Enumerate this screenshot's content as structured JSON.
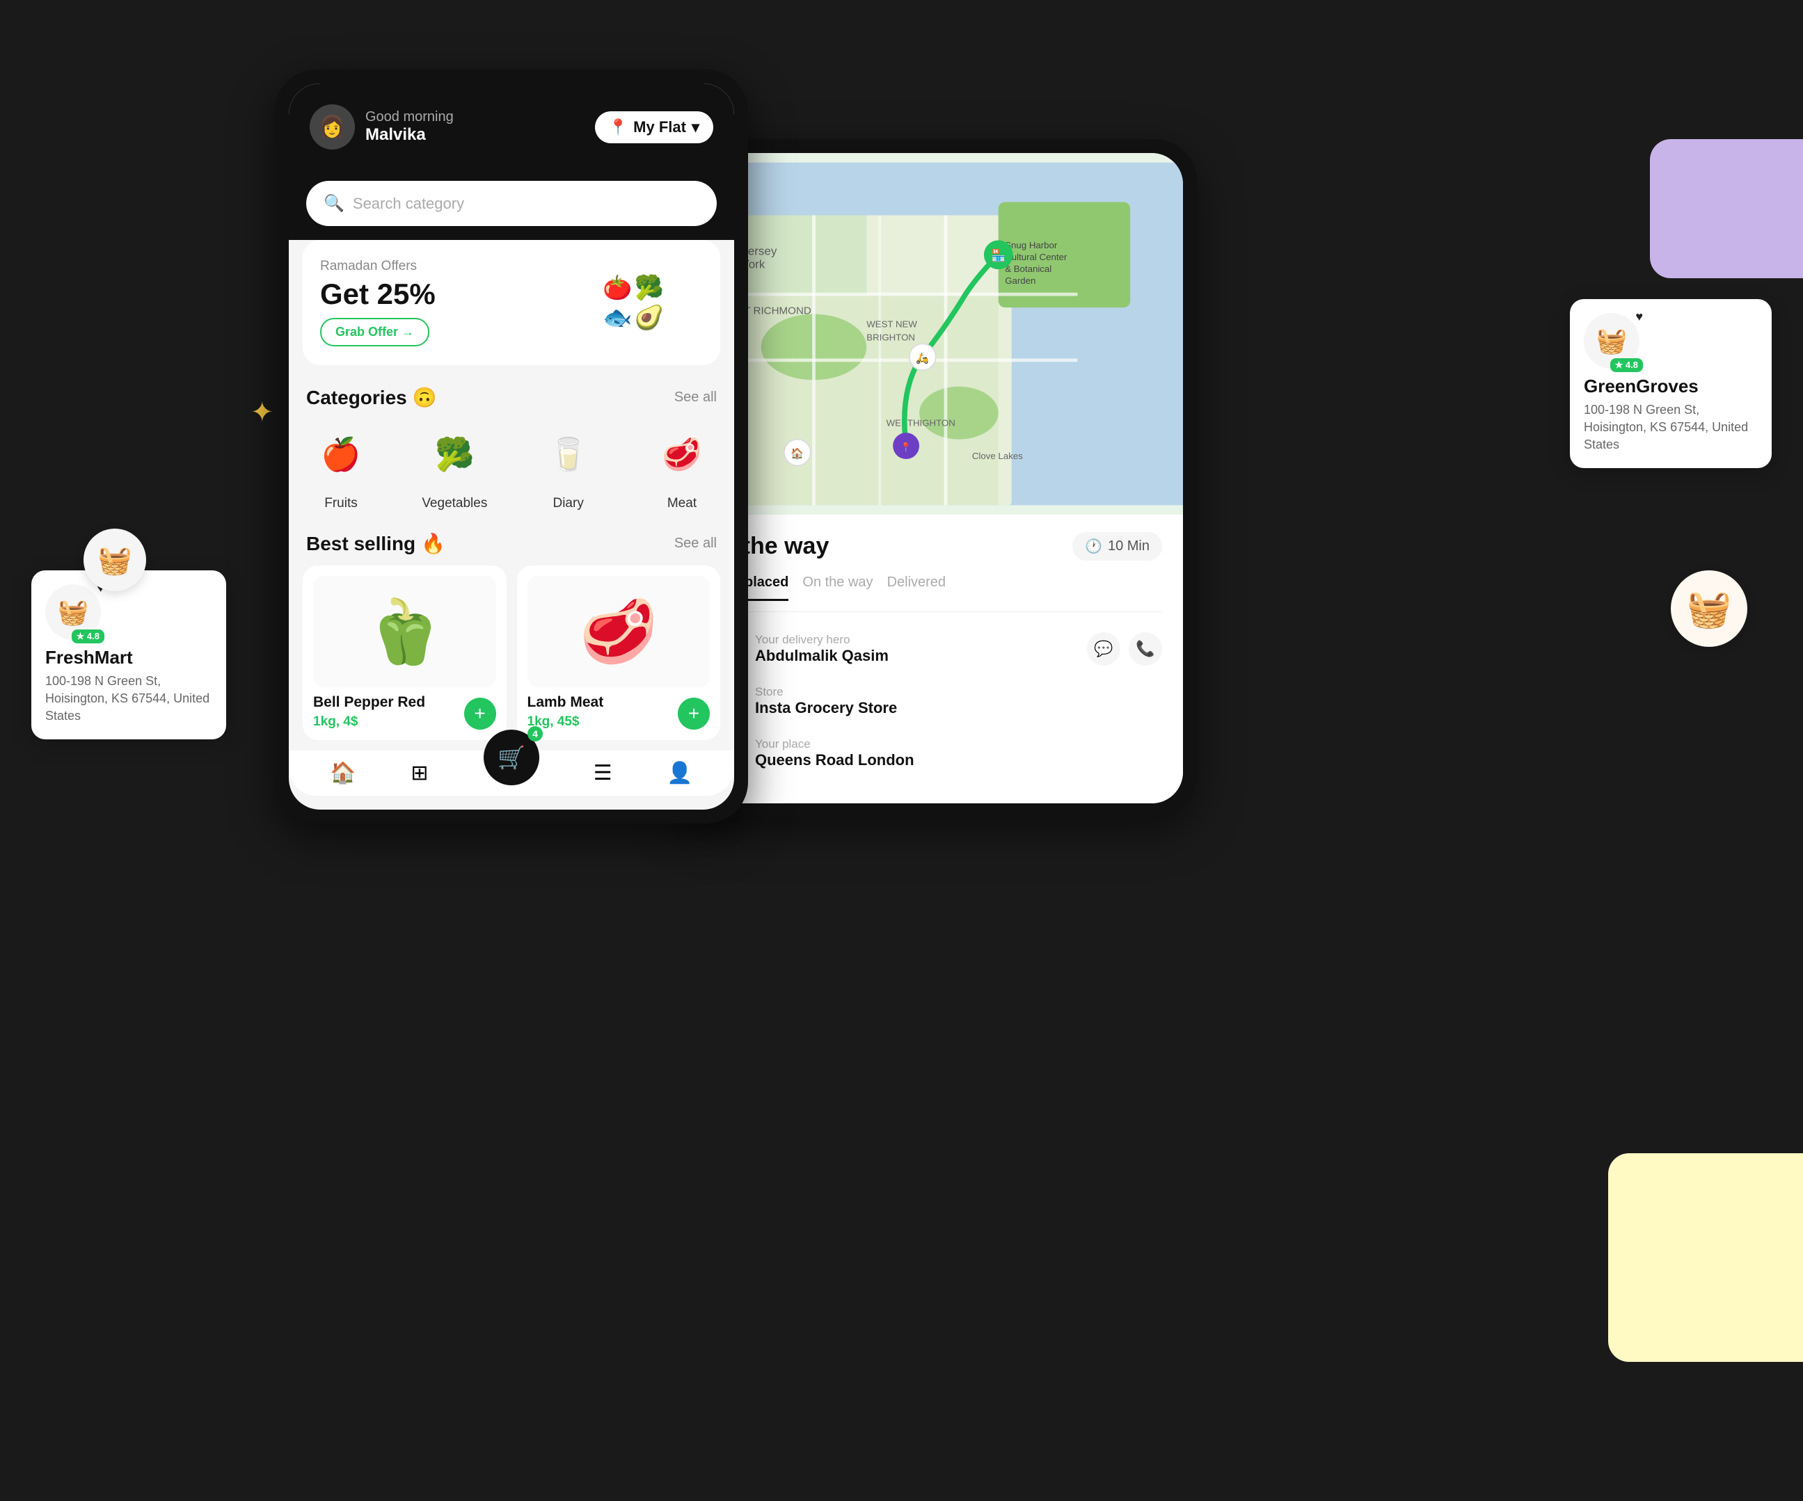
{
  "scene": {
    "bg_color": "#1a1a1a"
  },
  "freshmart_card": {
    "icon": "🧺",
    "rating": "★ 4.8",
    "name": "FreshMart",
    "address": "100-198 N Green St, Hoisington, KS 67544, United States"
  },
  "greengroves_card": {
    "icon": "🧺",
    "rating": "★ 4.8",
    "name": "GreenGroves",
    "address": "100-198 N Green St, Hoisington, KS 67544, United States"
  },
  "phone_main": {
    "header": {
      "greeting": "Good morning",
      "username": "Malvika",
      "location": "My Flat",
      "avatar_emoji": "👩"
    },
    "search": {
      "placeholder": "Search category"
    },
    "promo": {
      "label": "Ramadan Offers",
      "title": "Get 25%",
      "button": "Grab Offer →"
    },
    "categories": {
      "title": "Categories 🙃",
      "see_all": "See all",
      "items": [
        {
          "label": "Fruits",
          "icon": "🍎"
        },
        {
          "label": "Vegetables",
          "icon": "🥦"
        },
        {
          "label": "Diary",
          "icon": "🥛"
        },
        {
          "label": "Meat",
          "icon": "🥩"
        }
      ]
    },
    "best_selling": {
      "title": "Best selling 🔥",
      "see_all": "See all",
      "products": [
        {
          "name": "Bell Pepper Red",
          "price": "1kg, 4$",
          "icon": "🫑"
        },
        {
          "name": "Lamb Meat",
          "price": "1kg, 45$",
          "icon": "🥩"
        }
      ]
    },
    "bottom_nav": {
      "items": [
        "🏠",
        "⊞",
        "🛒",
        "☰",
        "👤"
      ],
      "cart_count": "4"
    }
  },
  "phone_map": {
    "delivery": {
      "title": "On the way",
      "time": "10 Min",
      "steps": [
        {
          "label": "Order placed",
          "active": true
        },
        {
          "label": "On the way",
          "active": false
        },
        {
          "label": "Delivered",
          "active": false
        }
      ],
      "hero": {
        "label": "Your delivery hero",
        "name": "Abdulmalik Qasim",
        "icon": "👤"
      },
      "store": {
        "label": "Store",
        "name": "Insta Grocery Store"
      },
      "place": {
        "label": "Your place",
        "name": "Queens Road London"
      }
    }
  }
}
